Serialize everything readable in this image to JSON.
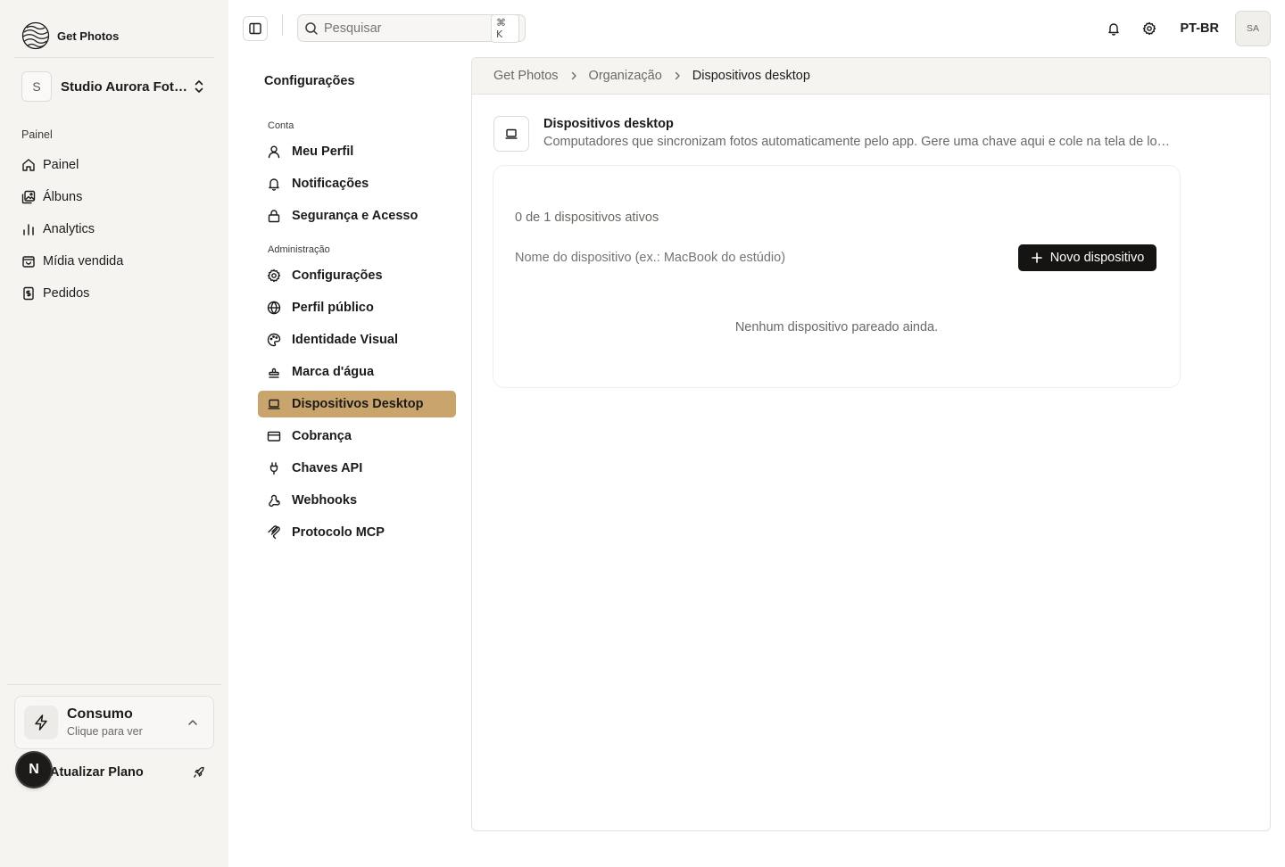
{
  "app": {
    "name": "Get Photos"
  },
  "org": {
    "initial": "S",
    "name": "Studio Aurora Fotografia"
  },
  "sidebar": {
    "group_label": "Painel",
    "items": [
      {
        "label": "Painel",
        "icon": "home-icon"
      },
      {
        "label": "Álbuns",
        "icon": "album-icon"
      },
      {
        "label": "Analytics",
        "icon": "bar-chart-icon"
      },
      {
        "label": "Mídia vendida",
        "icon": "shopping-bag-icon"
      },
      {
        "label": "Pedidos",
        "icon": "receipt-icon"
      }
    ],
    "usage": {
      "title": "Consumo",
      "subtitle": "Clique para ver"
    },
    "upgrade_label": "Atualizar Plano",
    "notification_badge": "N"
  },
  "topbar": {
    "search_placeholder": "Pesquisar",
    "search_shortcut": "⌘ K",
    "language": "PT-BR",
    "user_initials": "SA"
  },
  "settings": {
    "title": "Configurações",
    "groups": [
      {
        "label": "Conta",
        "items": [
          {
            "label": "Meu Perfil",
            "icon": "user-icon"
          },
          {
            "label": "Notificações",
            "icon": "bell-icon"
          },
          {
            "label": "Segurança e Acesso",
            "icon": "lock-icon"
          }
        ]
      },
      {
        "label": "Administração",
        "items": [
          {
            "label": "Configurações",
            "icon": "gear-icon"
          },
          {
            "label": "Perfil público",
            "icon": "globe-icon"
          },
          {
            "label": "Identidade Visual",
            "icon": "palette-icon"
          },
          {
            "label": "Marca d'água",
            "icon": "stamp-icon"
          },
          {
            "label": "Dispositivos Desktop",
            "icon": "laptop-icon",
            "active": true
          },
          {
            "label": "Cobrança",
            "icon": "credit-card-icon"
          },
          {
            "label": "Chaves API",
            "icon": "plug-icon"
          },
          {
            "label": "Webhooks",
            "icon": "webhook-icon"
          },
          {
            "label": "Protocolo MCP",
            "icon": "mcp-icon"
          }
        ]
      }
    ]
  },
  "breadcrumb": [
    "Get Photos",
    "Organização",
    "Dispositivos desktop"
  ],
  "page": {
    "title": "Dispositivos desktop",
    "description": "Computadores que sincronizam fotos automaticamente pelo app. Gere uma chave aqui e cole na tela de login do app desktop.",
    "active_count": "0 de 1 dispositivos ativos",
    "device_name_placeholder": "Nome do dispositivo (ex.: MacBook do estúdio)",
    "new_device_label": "Novo dispositivo",
    "empty_state": "Nenhum dispositivo pareado ainda."
  },
  "colors": {
    "active_nav": "#c9a46c",
    "primary_button": "#151413",
    "sidebar_bg": "#f5f4f1"
  }
}
